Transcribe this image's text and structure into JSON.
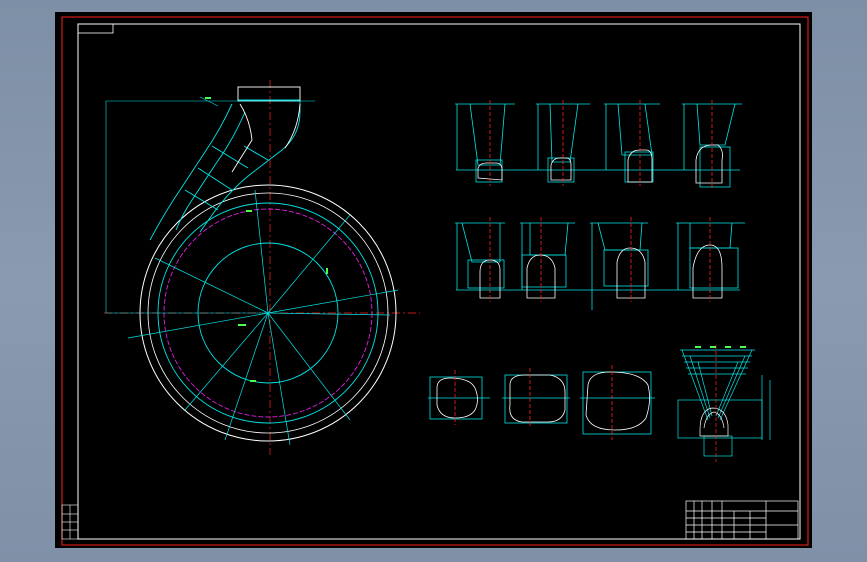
{
  "colors": {
    "background": "#000000",
    "frame": "#ff2020",
    "border": "#ffffff",
    "outline": "#ffffff",
    "geometry": "#00e5e5",
    "centerline": "#ff2020",
    "circle_accent": "#e020e0",
    "dimension_text": "#4cff4c",
    "note_text": "#d6ff2a"
  },
  "drawing": {
    "note": "",
    "views": [
      {
        "name": "volute-plan-view"
      },
      {
        "name": "section-row-1"
      },
      {
        "name": "section-row-2"
      },
      {
        "name": "section-row-3"
      },
      {
        "name": "throat-overlay-detail"
      }
    ]
  },
  "title_block": {
    "present": true
  }
}
